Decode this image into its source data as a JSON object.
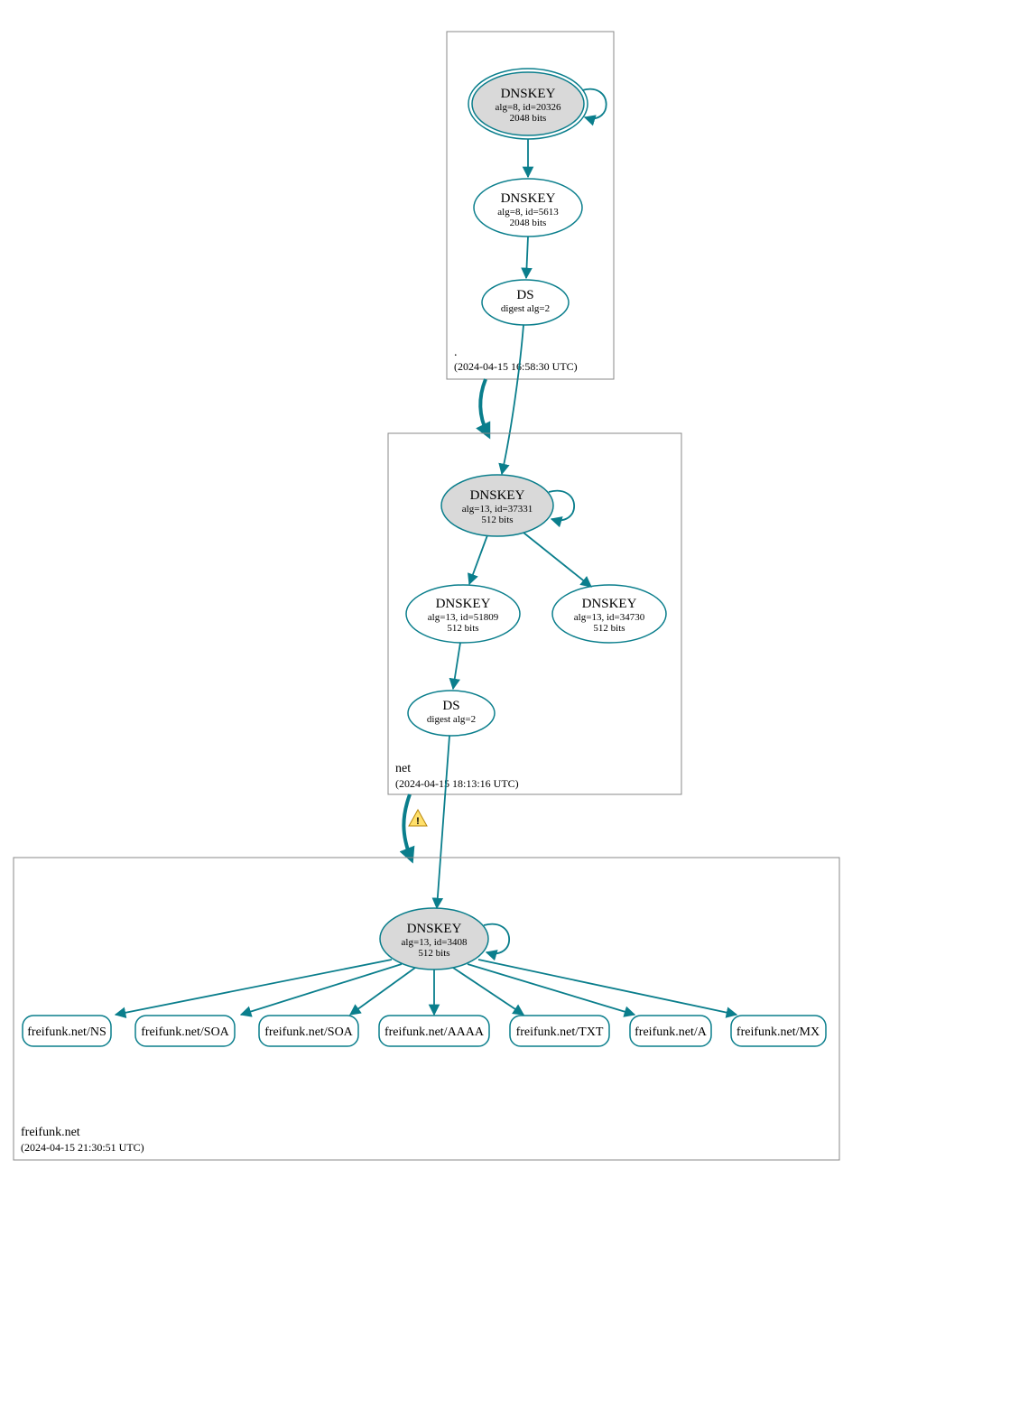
{
  "colors": {
    "teal": "#0a7e8c",
    "zone_border": "#888888",
    "key_fill": "#d9d9d9"
  },
  "zones": {
    "root": {
      "name": ".",
      "timestamp": "(2024-04-15 16:58:30 UTC)",
      "nodes": {
        "dnskey_ksk": {
          "title": "DNSKEY",
          "line1": "alg=8, id=20326",
          "line2": "2048 bits"
        },
        "dnskey_zsk": {
          "title": "DNSKEY",
          "line1": "alg=8, id=5613",
          "line2": "2048 bits"
        },
        "ds": {
          "title": "DS",
          "line1": "digest alg=2"
        }
      }
    },
    "net": {
      "name": "net",
      "timestamp": "(2024-04-15 18:13:16 UTC)",
      "nodes": {
        "dnskey_ksk": {
          "title": "DNSKEY",
          "line1": "alg=13, id=37331",
          "line2": "512 bits"
        },
        "dnskey_zsk1": {
          "title": "DNSKEY",
          "line1": "alg=13, id=51809",
          "line2": "512 bits"
        },
        "dnskey_zsk2": {
          "title": "DNSKEY",
          "line1": "alg=13, id=34730",
          "line2": "512 bits"
        },
        "ds": {
          "title": "DS",
          "line1": "digest alg=2"
        }
      }
    },
    "freifunk": {
      "name": "freifunk.net",
      "timestamp": "(2024-04-15 21:30:51 UTC)",
      "nodes": {
        "dnskey_ksk": {
          "title": "DNSKEY",
          "line1": "alg=13, id=3408",
          "line2": "512 bits"
        }
      },
      "rrsets": [
        "freifunk.net/NS",
        "freifunk.net/SOA",
        "freifunk.net/SOA",
        "freifunk.net/AAAA",
        "freifunk.net/TXT",
        "freifunk.net/A",
        "freifunk.net/MX"
      ]
    }
  },
  "edges": {
    "warning_on_net_to_freifunk": true
  }
}
